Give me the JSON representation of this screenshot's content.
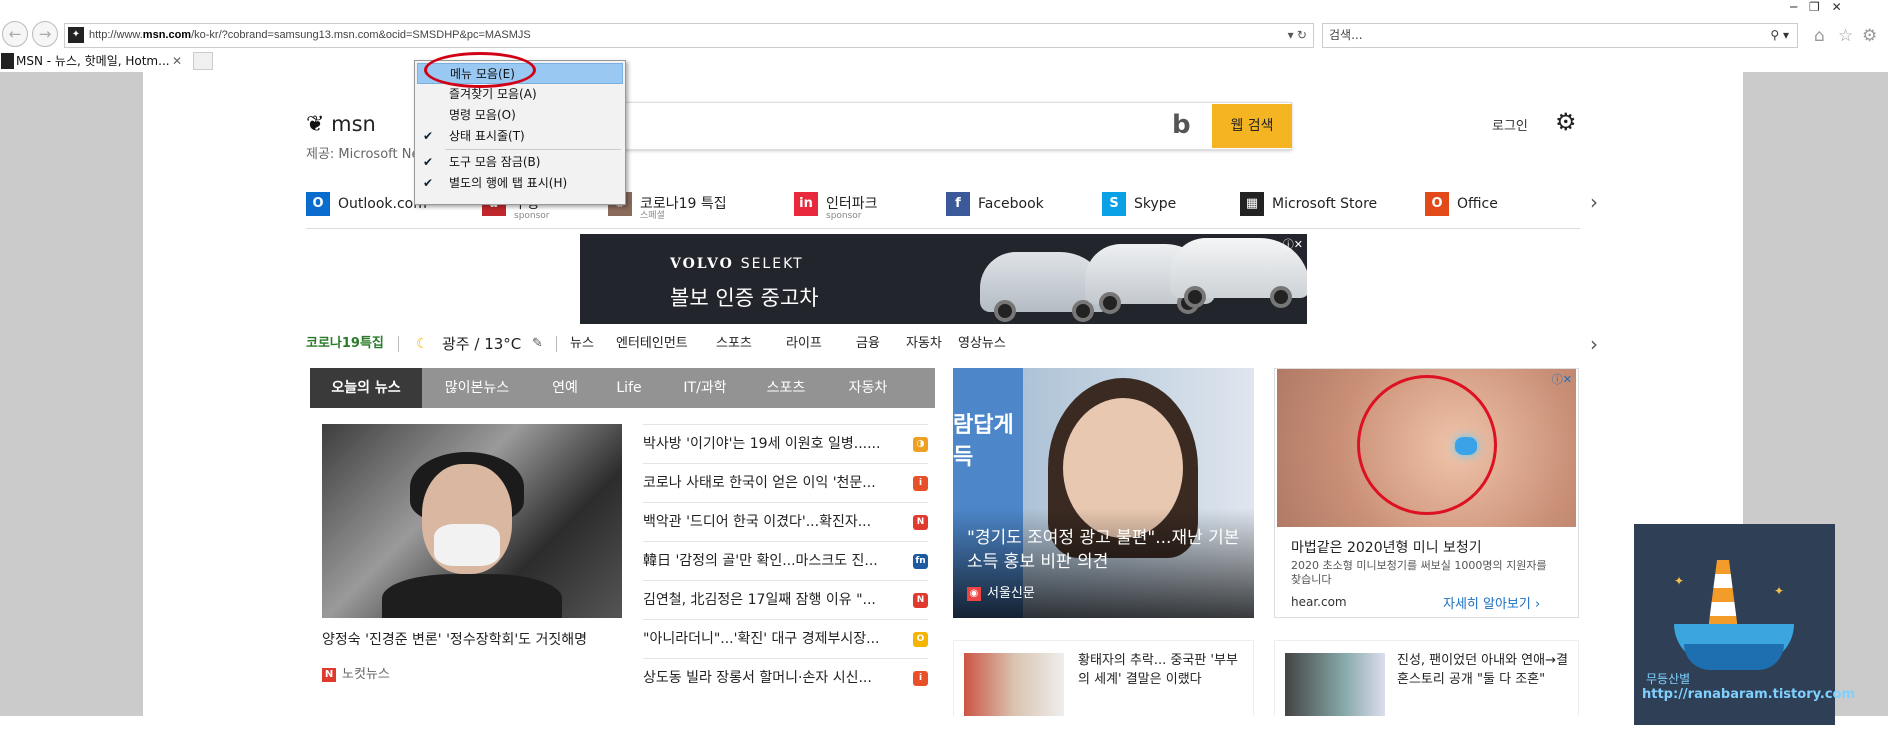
{
  "browser": {
    "url_prefix": "http://www.",
    "url_domain": "msn.com",
    "url_rest": "/ko-kr/?cobrand=samsung13.msn.com&ocid=SMSDHP&pc=MASMJS",
    "url_controls": "▾ ↻",
    "search_placeholder": "검색...",
    "search_controls": "⚲ ▾",
    "tab_title": "MSN - 뉴스, 핫메일, Hotm...",
    "tab_close": "✕",
    "window_controls": "─  ❐  ✕",
    "back": "←",
    "forward": "→",
    "icons": [
      "home-icon",
      "favorites-star-icon",
      "settings-gear-icon"
    ]
  },
  "context_menu": {
    "items": [
      {
        "label": "메뉴 모음(E)",
        "checked": false,
        "selected": true
      },
      {
        "label": "즐겨찾기 모음(A)",
        "checked": false
      },
      {
        "label": "명령 모음(O)",
        "checked": false
      },
      {
        "label": "상태 표시줄(T)",
        "checked": true
      },
      {
        "label": "도구 모음 잠금(B)",
        "checked": true
      },
      {
        "label": "별도의 행에 탭 표시(H)",
        "checked": true
      }
    ],
    "check_glyph": "✔"
  },
  "header": {
    "logo_text": "msn",
    "provider": "제공: Microsoft Ne",
    "bing_glyph": "b",
    "search_button": "웹 검색",
    "login": "로그인"
  },
  "quicklinks": [
    {
      "label": "Outlook.com",
      "icon_color": "#0a6ccf",
      "glyph": "O"
    },
    {
      "label": "쿠팡",
      "sub": "sponsor",
      "icon_color": "#c0282d",
      "glyph": "✿"
    },
    {
      "label": "코로나19 특집",
      "sub": "스페셜",
      "icon_color": "#8a6b5a",
      "glyph": "✺"
    },
    {
      "label": "인터파크",
      "sub": "sponsor",
      "icon_color": "#e8293b",
      "glyph": "in"
    },
    {
      "label": "Facebook",
      "icon_color": "#3b5998",
      "glyph": "f"
    },
    {
      "label": "Skype",
      "icon_color": "#0aa0e6",
      "glyph": "S"
    },
    {
      "label": "Microsoft Store",
      "icon_color": "#222222",
      "glyph": "▦"
    },
    {
      "label": "Office",
      "icon_color": "#e24a1a",
      "glyph": "O"
    }
  ],
  "ad_banner": {
    "brand": "VOLVO",
    "brand2": "SELEKT",
    "slogan": "볼보 인증 중고차",
    "adchoices": "ⓘ✕"
  },
  "categories": {
    "special": "코로나19특집",
    "weather": "광주 / 13°C",
    "items": [
      "뉴스",
      "엔터테인먼트",
      "스포츠",
      "라이프",
      "금융",
      "자동차",
      "영상뉴스"
    ]
  },
  "news_tabs": [
    "오늘의 뉴스",
    "많이본뉴스",
    "연예",
    "Life",
    "IT/과학",
    "스포츠",
    "자동차"
  ],
  "main_story": {
    "caption": "양정숙 '진경준 변론' '정수장학회'도 거짓해명",
    "source": "노컷뉴스",
    "source_glyph": "N"
  },
  "headlines": [
    {
      "text": "박사방 '이기야'는 19세 이원호 일병......",
      "color": "#f0a020",
      "glyph": "◑"
    },
    {
      "text": "코로나 사태로 한국이 얻은 이익 '천문...",
      "color": "#e8502a",
      "glyph": "i"
    },
    {
      "text": "백악관 '드디어 한국 이겼다'...확진자...",
      "color": "#e03a2f",
      "glyph": "N"
    },
    {
      "text": "韓日 '감정의 골'만 확인...마스크도 진...",
      "color": "#1e5aa0",
      "glyph": "fn"
    },
    {
      "text": "김연철, 北김정은 17일째 잠행 이유 \"...",
      "color": "#e03a2f",
      "glyph": "N"
    },
    {
      "text": "\"아니라더니\"...'확진' 대구 경제부시장...",
      "color": "#f5b400",
      "glyph": "O"
    },
    {
      "text": "상도동 빌라 장롱서 할머니·손자 시신...",
      "color": "#e8502a",
      "glyph": "i"
    }
  ],
  "feature_tile": {
    "overlay": "람답게\n득",
    "caption": "\"경기도 조여정 광고 불편\"...재난 기본소득 홍보 비판 의견",
    "source": "서울신문"
  },
  "ad_tile": {
    "title": "마법같은 2020년형 미니 보청기",
    "desc": "2020 초소형 미니보청기를 써보실 1000명의 지원자를 찾습니다",
    "domain": "hear.com",
    "more": "자세히 알아보기 ›",
    "adchoices": "ⓘ✕"
  },
  "card2": {
    "text": "황태자의 추락... 중국판 '부부의 세계' 결말은 이랬다"
  },
  "card3": {
    "text": "진성, 팬이었던 아내와 연애→결혼스토리 공개 \"둘 다 조혼\""
  },
  "watermark": {
    "name": "무등산별",
    "url": "http://ranabaram.tistory.com"
  }
}
